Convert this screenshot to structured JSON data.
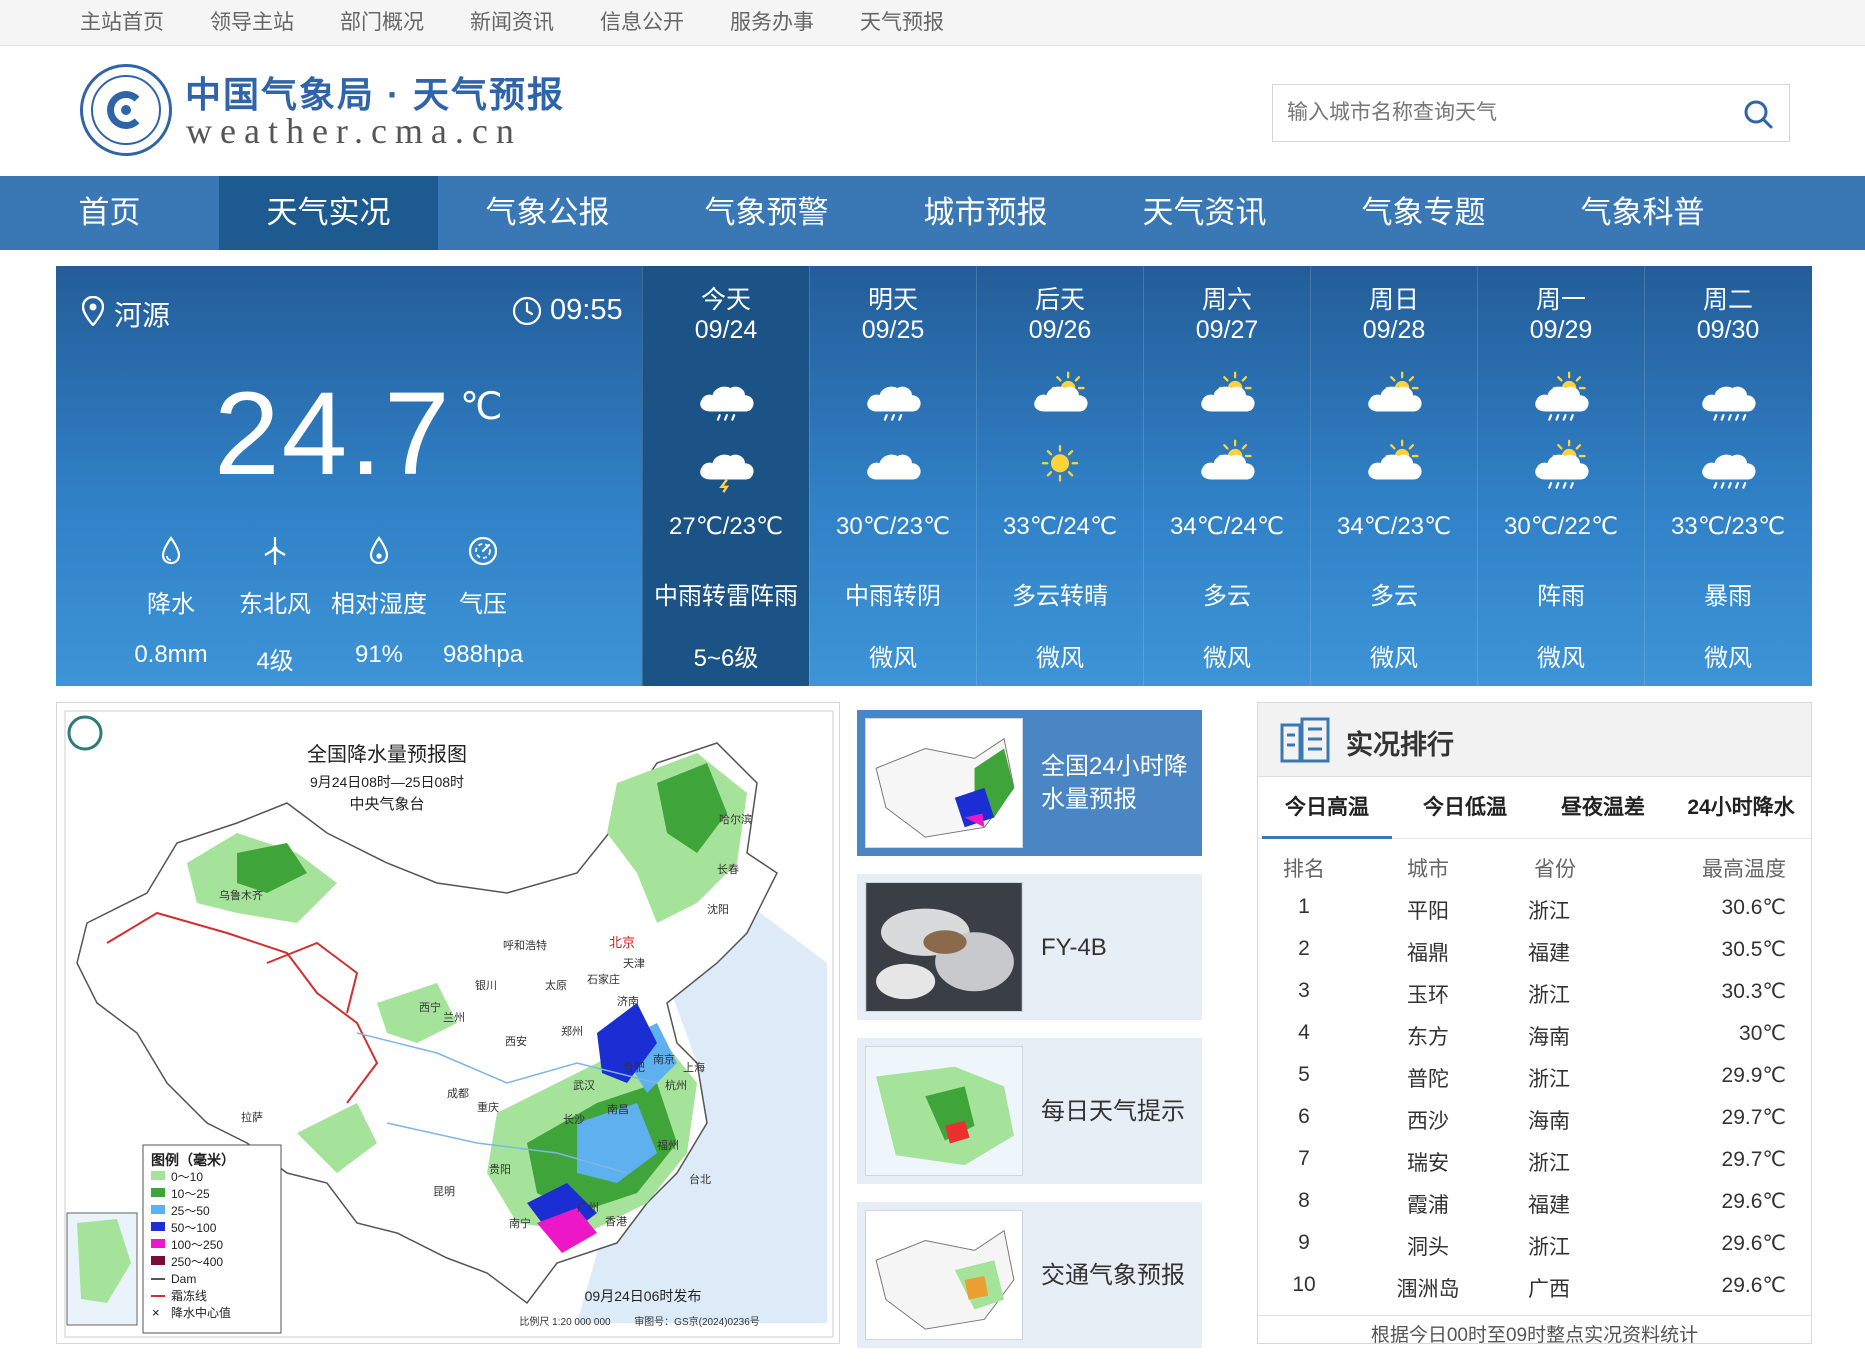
{
  "topbar": {
    "items": [
      "主站首页",
      "领导主站",
      "部门概况",
      "新闻资讯",
      "信息公开",
      "服务办事",
      "天气预报"
    ]
  },
  "header": {
    "title": "中国气象局 · 天气预报",
    "url": "weather.cma.cn",
    "search_placeholder": "输入城市名称查询天气",
    "brand_color": "#2f64a8"
  },
  "nav": {
    "items": [
      "首页",
      "天气实况",
      "气象公报",
      "气象预警",
      "城市预报",
      "天气资讯",
      "气象专题",
      "气象科普"
    ],
    "active": "天气实况",
    "color": "#3a78b5",
    "active_color": "#1d5a90"
  },
  "current": {
    "location": "河源",
    "time": "09:55",
    "temperature": "24.7",
    "unit": "℃",
    "metrics": [
      {
        "icon": "raindrop-icon",
        "label": "降水",
        "value": "0.8mm"
      },
      {
        "icon": "wind-turbine-icon",
        "label": "东北风",
        "value": "4级"
      },
      {
        "icon": "humidity-icon",
        "label": "相对湿度",
        "value": "91%"
      },
      {
        "icon": "pressure-gauge-icon",
        "label": "气压",
        "value": "988hpa"
      }
    ]
  },
  "forecast": [
    {
      "day": "今天",
      "date": "09/24",
      "icon_day": "cloud-rain-icon",
      "icon_night": "cloud-thunder-icon",
      "temp": "27℃/23℃",
      "desc": "中雨转雷阵雨",
      "wind": "5~6级"
    },
    {
      "day": "明天",
      "date": "09/25",
      "icon_day": "cloud-rain-icon",
      "icon_night": "cloudy-icon",
      "temp": "30℃/23℃",
      "desc": "中雨转阴",
      "wind": "微风"
    },
    {
      "day": "后天",
      "date": "09/26",
      "icon_day": "partly-cloudy-icon",
      "icon_night": "sunny-icon",
      "temp": "33℃/24℃",
      "desc": "多云转晴",
      "wind": "微风"
    },
    {
      "day": "周六",
      "date": "09/27",
      "icon_day": "partly-cloudy-icon",
      "icon_night": "partly-cloudy-icon",
      "temp": "34℃/24℃",
      "desc": "多云",
      "wind": "微风"
    },
    {
      "day": "周日",
      "date": "09/28",
      "icon_day": "partly-cloudy-icon",
      "icon_night": "partly-cloudy-icon",
      "temp": "34℃/23℃",
      "desc": "多云",
      "wind": "微风"
    },
    {
      "day": "周一",
      "date": "09/29",
      "icon_day": "sun-shower-icon",
      "icon_night": "sun-shower-icon",
      "temp": "30℃/22℃",
      "desc": "阵雨",
      "wind": "微风"
    },
    {
      "day": "周二",
      "date": "09/30",
      "icon_day": "heavy-rain-icon",
      "icon_night": "heavy-rain-icon",
      "temp": "33℃/23℃",
      "desc": "暴雨",
      "wind": "微风"
    }
  ],
  "map": {
    "title": "全国降水量预报图",
    "subtitle": "9月24日08时—25日08时",
    "agency": "中央气象台",
    "issued": "09月24日06时发布",
    "scale": "比例尺 1:20 000 000",
    "map_no": "审图号：GS京(2024)0236号",
    "legend_title": "图例（毫米）",
    "legend": [
      {
        "label": "0～10",
        "color": "#a6e39a"
      },
      {
        "label": "10～25",
        "color": "#3fa43a"
      },
      {
        "label": "25～50",
        "color": "#5fb0ef"
      },
      {
        "label": "50～100",
        "color": "#1a2ed4"
      },
      {
        "label": "100～250",
        "color": "#ec18c8"
      },
      {
        "label": "250～400",
        "color": "#7a0e3a"
      },
      {
        "label": "Dam",
        "color": "#555555"
      },
      {
        "label": "霜冻线",
        "color": "#d03030"
      },
      {
        "label": "降水中心值",
        "color": "#111111"
      }
    ],
    "cities": [
      "北京",
      "天津",
      "呼和浩特",
      "沈阳",
      "长春",
      "哈尔滨",
      "石家庄",
      "太原",
      "济南",
      "银川",
      "西宁",
      "兰州",
      "郑州",
      "西安",
      "成都",
      "重庆",
      "武汉",
      "合肥",
      "南京",
      "上海",
      "杭州",
      "长沙",
      "南昌",
      "福州",
      "台北",
      "贵阳",
      "昆明",
      "南宁",
      "广州",
      "香港",
      "拉萨",
      "乌鲁木齐"
    ]
  },
  "thumbnails": [
    {
      "label": "全国24小时降水量预报",
      "active": true
    },
    {
      "label": "FY-4B",
      "active": false
    },
    {
      "label": "每日天气提示",
      "active": false
    },
    {
      "label": "交通气象预报",
      "active": false
    }
  ],
  "ranking": {
    "title": "实况排行",
    "tabs": [
      "今日高温",
      "今日低温",
      "昼夜温差",
      "24小时降水"
    ],
    "active_tab": "今日高温",
    "headers": [
      "排名",
      "城市",
      "省份",
      "最高温度"
    ],
    "rows": [
      [
        "1",
        "平阳",
        "浙江",
        "30.6℃"
      ],
      [
        "2",
        "福鼎",
        "福建",
        "30.5℃"
      ],
      [
        "3",
        "玉环",
        "浙江",
        "30.3℃"
      ],
      [
        "4",
        "东方",
        "海南",
        "30℃"
      ],
      [
        "5",
        "普陀",
        "浙江",
        "29.9℃"
      ],
      [
        "6",
        "西沙",
        "海南",
        "29.7℃"
      ],
      [
        "7",
        "瑞安",
        "浙江",
        "29.7℃"
      ],
      [
        "8",
        "霞浦",
        "福建",
        "29.6℃"
      ],
      [
        "9",
        "洞头",
        "浙江",
        "29.6℃"
      ],
      [
        "10",
        "涠洲岛",
        "广西",
        "29.6℃"
      ]
    ],
    "note": "根据今日00时至09时整点实况资料统计"
  }
}
